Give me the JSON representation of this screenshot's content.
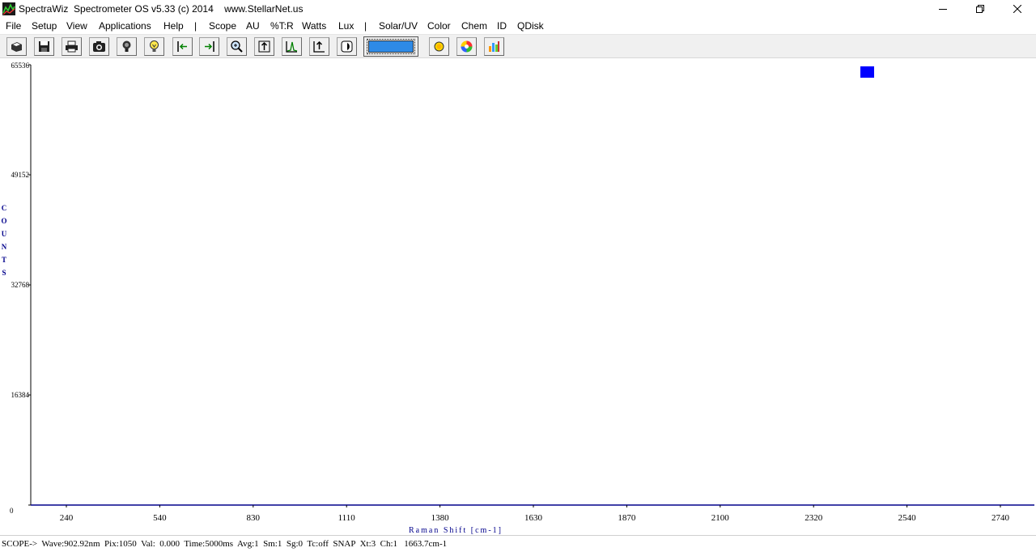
{
  "window": {
    "title": "SpectraWiz  Spectrometer OS v5.33 (c) 2014    www.StellarNet.us"
  },
  "menu": {
    "items": [
      "File",
      "Setup",
      "View",
      "Applications",
      "Help",
      "|",
      "Scope",
      "AU",
      "%T:R",
      "Watts",
      "Lux",
      "|",
      "Solar/UV",
      "Color",
      "Chem",
      "ID",
      "QDisk"
    ]
  },
  "toolbar": {
    "icons": [
      "open-icon",
      "save-icon",
      "print-icon",
      "camera-icon",
      "dark-bulb-icon",
      "light-bulb-icon",
      "scroll-left-icon",
      "scroll-right-icon",
      "zoom-icon",
      "autoscale-icon",
      "peak-icon",
      "rescale-up-icon",
      "half-circle-icon",
      "sun-icon",
      "color-wheel-icon",
      "chart-icon"
    ],
    "swatch_color": "#2e8ae6"
  },
  "chart_data": {
    "type": "line",
    "xlabel": "Raman Shift [cm-1]",
    "ylabel": "COUNTS",
    "x_ticks": [
      "240",
      "540",
      "830",
      "1110",
      "1380",
      "1630",
      "1870",
      "2100",
      "2320",
      "2540",
      "2740"
    ],
    "y_ticks": [
      "65536",
      "49152",
      "32768",
      "16384",
      "0"
    ],
    "ylim": [
      0,
      65536
    ],
    "series": [],
    "grid": false,
    "legend_marker_color": "#0000ff",
    "axis_color": "#00008b"
  },
  "status": {
    "text": "SCOPE->  Wave:902.92nm  Pix:1050  Val:  0.000  Time:5000ms  Avg:1  Sm:1  Sg:0  Tc:off  SNAP  Xt:3  Ch:1   1663.7cm-1"
  }
}
